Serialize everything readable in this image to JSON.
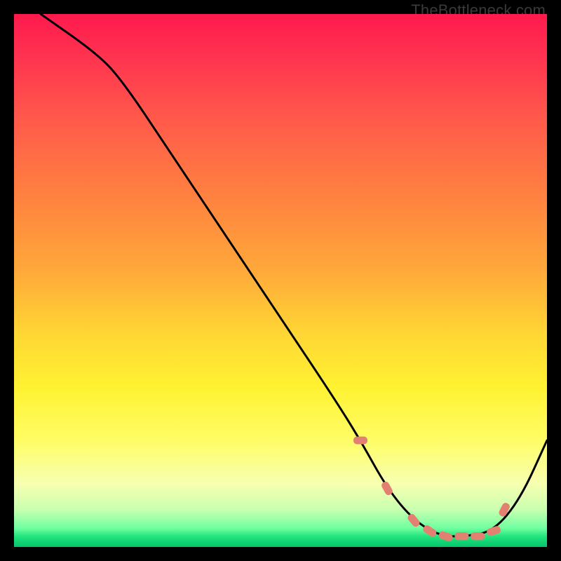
{
  "watermark": "TheBottleneck.com",
  "chart_data": {
    "type": "line",
    "title": "",
    "xlabel": "",
    "ylabel": "",
    "xlim": [
      0,
      100
    ],
    "ylim": [
      0,
      100
    ],
    "grid": false,
    "legend": false,
    "background": "rainbow-gradient (red high → green low)",
    "series": [
      {
        "name": "bottleneck-curve",
        "color": "#000000",
        "x": [
          5,
          15,
          20,
          30,
          40,
          50,
          60,
          65,
          70,
          75,
          80,
          85,
          90,
          95,
          100
        ],
        "values": [
          100,
          93,
          88,
          73,
          58,
          43,
          28,
          20,
          11,
          5,
          2,
          2,
          3,
          9,
          20
        ]
      }
    ],
    "markers": {
      "name": "highlight-dots",
      "color": "#e28072",
      "shape": "rounded-rect",
      "x": [
        65,
        70,
        75,
        78,
        81,
        84,
        87,
        90,
        92
      ],
      "values": [
        20,
        11,
        5,
        3,
        2,
        2,
        2,
        3,
        7
      ]
    }
  }
}
